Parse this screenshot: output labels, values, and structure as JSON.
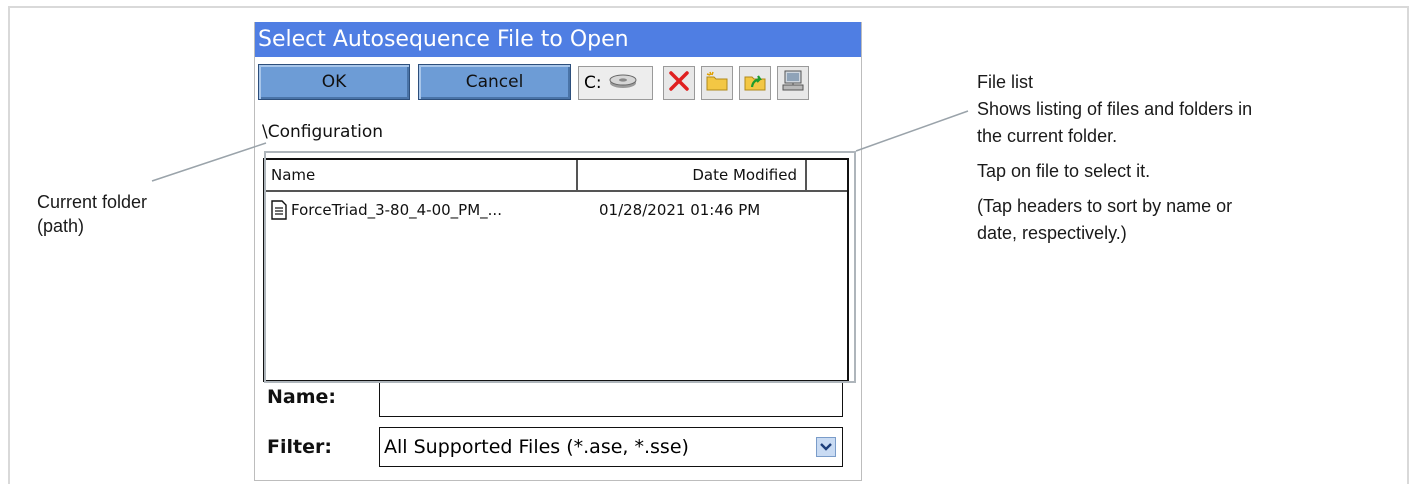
{
  "dialog": {
    "title": "Select Autosequence File to Open",
    "ok_label": "OK",
    "cancel_label": "Cancel",
    "drive_label": "C:",
    "toolbar_icons": [
      "drive-icon",
      "delete-icon",
      "new-folder-icon",
      "up-folder-icon",
      "network-icon"
    ],
    "current_path": "\\Configuration",
    "list": {
      "columns": [
        "Name",
        "Date Modified"
      ],
      "rows": [
        {
          "name": "ForceTriad_3-80_4-00_PM_...",
          "date": "01/28/2021 01:46 PM"
        }
      ]
    },
    "name_label": "Name:",
    "name_value": "",
    "filter_label": "Filter:",
    "filter_value": "All Supported Files (*.ase, *.sse)"
  },
  "annotations": {
    "current_folder": [
      "Current folder",
      "(path)"
    ],
    "file_list_title": "File list",
    "file_list_desc": [
      "Shows listing of files and folders in",
      "the current folder."
    ],
    "tap_select": "Tap on file to select it.",
    "tap_headers": [
      "(Tap headers to sort by name or",
      "date, respectively.)"
    ]
  },
  "colors": {
    "titlebar": "#4f7ee3",
    "button": "#6d9cd6",
    "highlight_border": "#aeb5bb"
  }
}
